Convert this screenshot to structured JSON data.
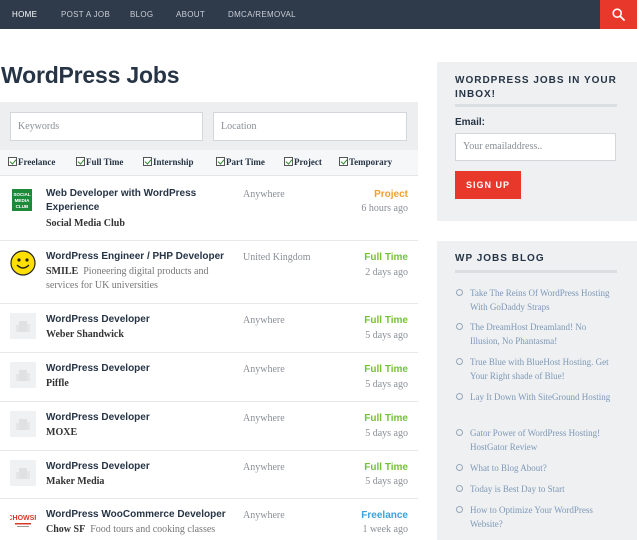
{
  "nav": {
    "items": [
      "HOME",
      "POST A JOB",
      "BLOG",
      "ABOUT",
      "DMCA/REMOVAL"
    ]
  },
  "main": {
    "title": "WordPress Jobs",
    "keywords_placeholder": "Keywords",
    "location_placeholder": "Location",
    "types": [
      "Freelance",
      "Full Time",
      "Internship",
      "Part Time",
      "Project",
      "Temporary"
    ]
  },
  "jobs": [
    {
      "title": "Web Developer with WordPress Experience",
      "company": "Social Media Club",
      "tagline": "",
      "location": "Anywhere",
      "type": "Project",
      "date": "6 hours ago",
      "logo": "social-media-club-logo"
    },
    {
      "title": "WordPress Engineer / PHP Developer",
      "company": "SMILE",
      "tagline": "Pioneering digital products and services for UK universities",
      "location": "United Kingdom",
      "type": "Full Time",
      "date": "2 days ago",
      "logo": "smile-logo"
    },
    {
      "title": "WordPress Developer",
      "company": "Weber Shandwick",
      "tagline": "",
      "location": "Anywhere",
      "type": "Full Time",
      "date": "5 days ago",
      "logo": "placeholder-logo"
    },
    {
      "title": "WordPress Developer",
      "company": "Piffle",
      "tagline": "",
      "location": "Anywhere",
      "type": "Full Time",
      "date": "5 days ago",
      "logo": "placeholder-logo"
    },
    {
      "title": "WordPress Developer",
      "company": "MOXE",
      "tagline": "",
      "location": "Anywhere",
      "type": "Full Time",
      "date": "5 days ago",
      "logo": "placeholder-logo"
    },
    {
      "title": "WordPress Developer",
      "company": "Maker Media",
      "tagline": "",
      "location": "Anywhere",
      "type": "Full Time",
      "date": "5 days ago",
      "logo": "placeholder-logo"
    },
    {
      "title": "WordPress WooCommerce Developer",
      "company": "Chow SF",
      "tagline": "Food tours and cooking classes",
      "location": "Anywhere",
      "type": "Freelance",
      "date": "1 week ago",
      "logo": "chowsf-logo"
    }
  ],
  "type_colors": {
    "Project": "#f0a030",
    "Full Time": "#77c13a",
    "Freelance": "#3aa3d9"
  },
  "sidebar": {
    "newsletter": {
      "title": "WORDPRESS JOBS IN YOUR INBOX!",
      "email_label": "Email:",
      "email_placeholder": "Your emailaddress..",
      "button": "SIGN UP"
    },
    "blog": {
      "title": "WP JOBS BLOG",
      "posts": [
        "Take The Reins Of WordPress Hosting With GoDaddy Straps",
        "The DreamHost Dreamland! No Illusion, No Phantasma!",
        "True Blue with BlueHost Hosting. Get Your Right shade of Blue!",
        "Lay It Down With SiteGround Hosting",
        "Gator Power of WordPress Hosting! HostGator Review",
        "What to Blog About?",
        "Today is Best Day to Start",
        "How to Optimize Your WordPress Website?"
      ]
    }
  },
  "colors": {
    "nav_bg": "#2f3a4b",
    "accent_red": "#e8382c",
    "heading": "#263445",
    "link": "#7e98b8"
  }
}
